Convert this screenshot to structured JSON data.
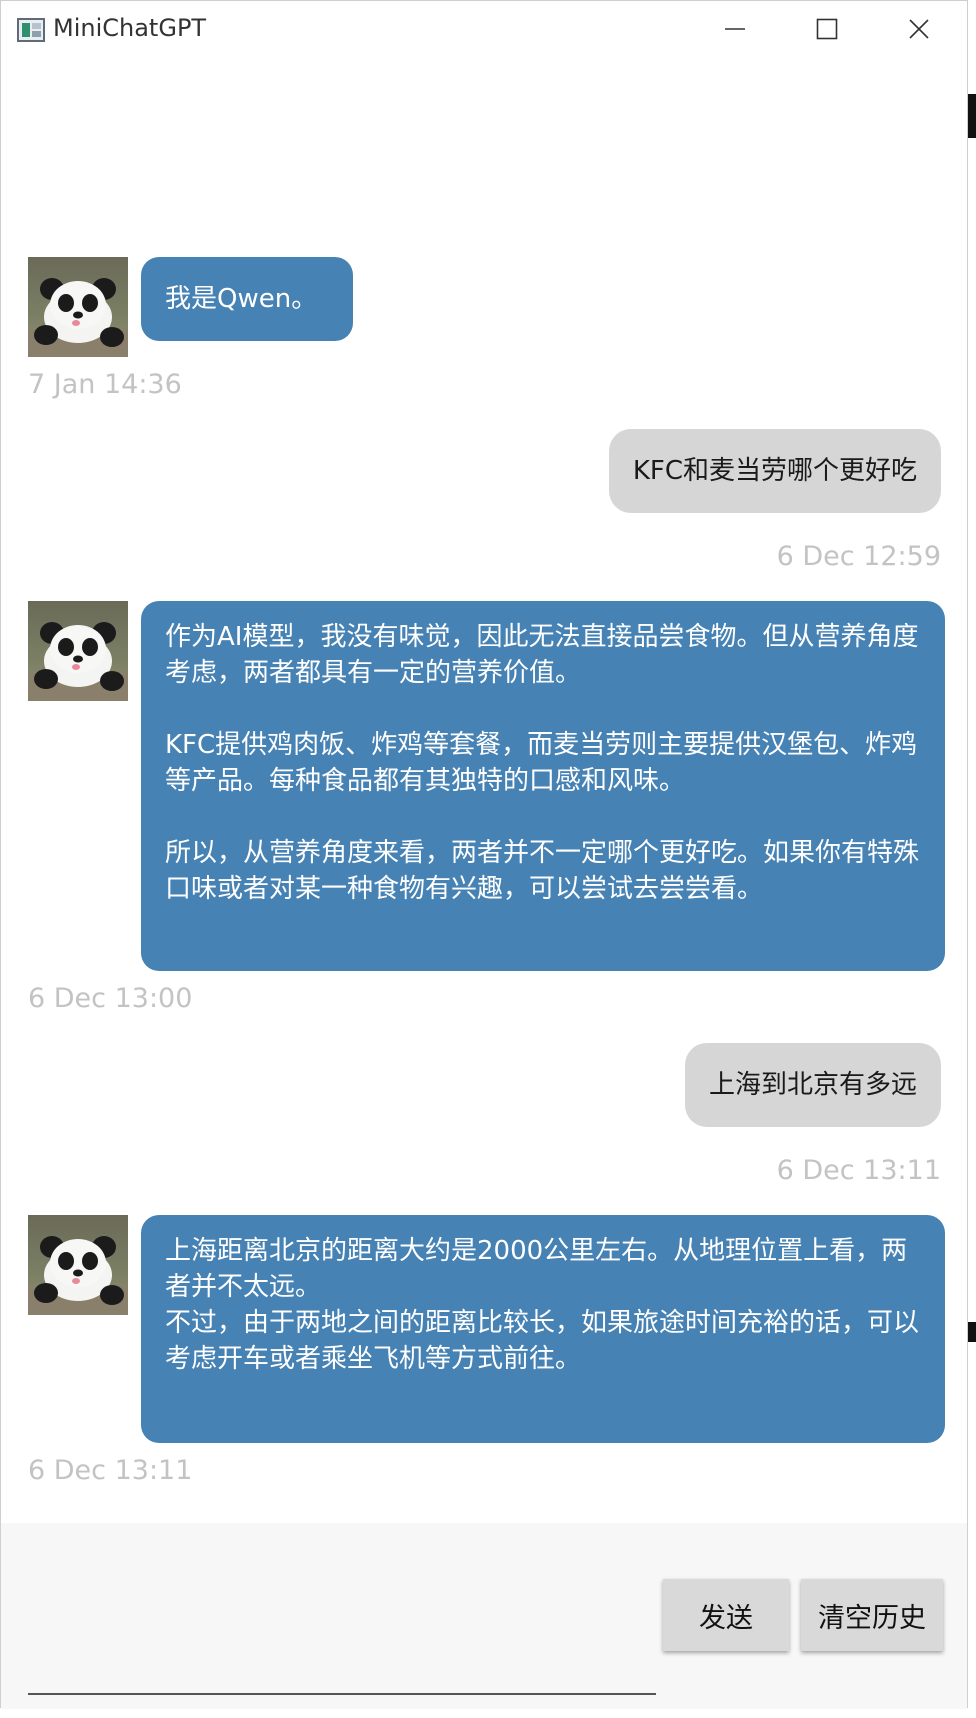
{
  "window": {
    "title": "MiniChatGPT",
    "controls": [
      "minimize-icon",
      "maximize-icon",
      "close-icon"
    ]
  },
  "messages": [
    {
      "role": "bot",
      "text": [
        "我是Qwen。"
      ],
      "time": "7 Jan 14:36"
    },
    {
      "role": "user",
      "text": [
        "KFC和麦当劳哪个更好吃"
      ],
      "time": "6 Dec 12:59"
    },
    {
      "role": "bot",
      "text": [
        "作为AI模型，我没有味觉，因此无法直接品尝食物。但从营养角度考虑，两者都具有一定的营养价值。",
        "KFC提供鸡肉饭、炸鸡等套餐，而麦当劳则主要提供汉堡包、炸鸡等产品。每种食品都有其独特的口感和风味。",
        "所以，从营养角度来看，两者并不一定哪个更好吃。如果你有特殊口味或者对某一种食物有兴趣，可以尝试去尝尝看。"
      ],
      "time": "6 Dec 13:00"
    },
    {
      "role": "user",
      "text": [
        "上海到北京有多远"
      ],
      "time": "6 Dec 13:11"
    },
    {
      "role": "bot",
      "text": [
        "上海距离北京的距离大约是2000公里左右。从地理位置上看，两者并不太远。\n不过，由于两地之间的距离比较长，如果旅途时间充裕的话，可以考虑开车或者乘坐飞机等方式前往。"
      ],
      "time": "6 Dec 13:11"
    }
  ],
  "input": {
    "value": "",
    "placeholder": ""
  },
  "buttons": {
    "send": "发送",
    "clear": "清空历史"
  },
  "colors": {
    "bot_bubble": "#4682b4",
    "user_bubble": "#d6d6d6",
    "timestamp": "#c3c3c3",
    "bottom_panel": "#f7f7f7"
  }
}
